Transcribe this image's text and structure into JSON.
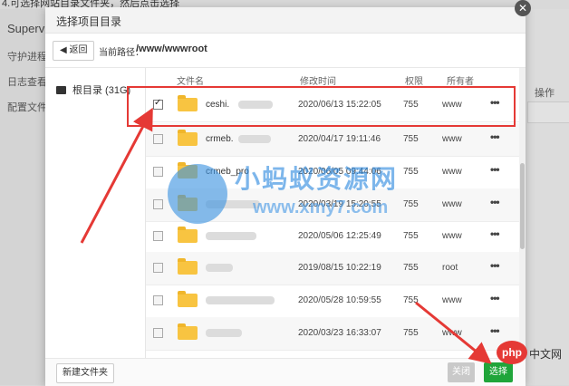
{
  "background": {
    "caption": "4.可选择网站目录文件夹，然后点击选择",
    "sidebar": {
      "brand": "Supervis",
      "items": [
        "守护进程管",
        "日志查看",
        "配置文件"
      ]
    },
    "right_label": "操作"
  },
  "dialog": {
    "title": "选择项目目录",
    "back_label": "返回",
    "path_label": "当前路径：",
    "path_value": "/www/wwwroot",
    "root_label": "根目录 (31G)",
    "columns": {
      "name": "文件名",
      "mtime": "修改时间",
      "perm": "权限",
      "owner": "所有者"
    },
    "rows": [
      {
        "name": "ceshi.",
        "date": "2020/06/13 15:22:05",
        "perm": "755",
        "owner": "www",
        "checked": true
      },
      {
        "name": "crmeb.",
        "date": "2020/04/17 19:11:46",
        "perm": "755",
        "owner": "www",
        "checked": false
      },
      {
        "name": "crmeb_pro",
        "date": "2020/06/05 09:44:06",
        "perm": "755",
        "owner": "www",
        "checked": false
      },
      {
        "name": "",
        "date": "2020/03/19 15:20:55",
        "perm": "755",
        "owner": "www",
        "checked": false
      },
      {
        "name": "",
        "date": "2020/05/06 12:25:49",
        "perm": "755",
        "owner": "www",
        "checked": false
      },
      {
        "name": "",
        "date": "2019/08/15 10:22:19",
        "perm": "755",
        "owner": "root",
        "checked": false
      },
      {
        "name": "",
        "date": "2020/05/28 10:59:55",
        "perm": "755",
        "owner": "www",
        "checked": false
      },
      {
        "name": "",
        "date": "2020/03/23 16:33:07",
        "perm": "755",
        "owner": "www",
        "checked": false
      }
    ],
    "more_label": "•••",
    "new_folder_label": "新建文件夹",
    "close_label": "关闭",
    "select_label": "选择"
  },
  "watermark": {
    "title": "小蚂蚁资源网",
    "url": "www.xmy7.com"
  },
  "php_badge": {
    "logo": "php",
    "text": "中文网"
  },
  "colors": {
    "accent_green": "#20a53a",
    "highlight_red": "#e53935",
    "folder": "#f8c441"
  }
}
